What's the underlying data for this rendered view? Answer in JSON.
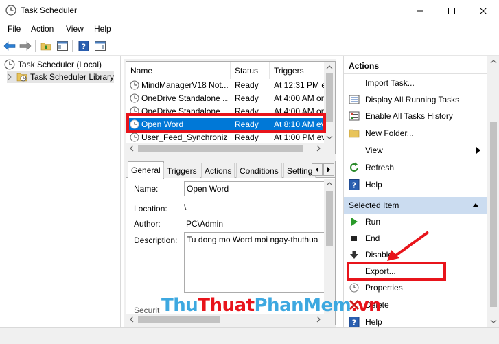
{
  "window": {
    "title": "Task Scheduler"
  },
  "menu": [
    "File",
    "Action",
    "View",
    "Help"
  ],
  "tree": {
    "root": "Task Scheduler (Local)",
    "library": "Task Scheduler Library"
  },
  "task_list": {
    "columns": [
      "Name",
      "Status",
      "Triggers"
    ],
    "rows": [
      {
        "name": "MindManagerV18 Not...",
        "status": "Ready",
        "trigger": "At 12:31 PM ev"
      },
      {
        "name": "OneDrive Standalone ...",
        "status": "Ready",
        "trigger": "At 4:00 AM on"
      },
      {
        "name": "OneDrive Standalone ...",
        "status": "Ready",
        "trigger": "At 4:00 AM on"
      },
      {
        "name": "Open Word",
        "status": "Ready",
        "trigger": "At 8:10 AM ev"
      },
      {
        "name": "User_Feed_Synchroniz...",
        "status": "Ready",
        "trigger": "At 1:00 PM ev"
      }
    ],
    "selected_index": 3
  },
  "details": {
    "tabs": [
      "General",
      "Triggers",
      "Actions",
      "Conditions",
      "Setting"
    ],
    "active_tab": "General",
    "name_label": "Name:",
    "name_value": "Open Word",
    "location_label": "Location:",
    "location_value": "\\",
    "author_label": "Author:",
    "author_value": "PC\\Admin",
    "description_label": "Description:",
    "description_value": "Tu dong mo Word moi ngay-thuthua",
    "security_partial": "Securit"
  },
  "actions_pane": {
    "header": "Actions",
    "items": [
      {
        "label": "Import Task...",
        "icon": "blank-icon"
      },
      {
        "label": "Display All Running Tasks",
        "icon": "running-tasks-icon"
      },
      {
        "label": "Enable All Tasks History",
        "icon": "history-icon"
      },
      {
        "label": "New Folder...",
        "icon": "folder-icon"
      },
      {
        "label": "View",
        "icon": "blank-icon"
      },
      {
        "label": "Refresh",
        "icon": "refresh-icon"
      },
      {
        "label": "Help",
        "icon": "help-icon"
      }
    ],
    "selected_header": "Selected Item",
    "selected_items": [
      {
        "label": "Run",
        "icon": "run-icon"
      },
      {
        "label": "End",
        "icon": "end-icon"
      },
      {
        "label": "Disable",
        "icon": "disable-icon"
      },
      {
        "label": "Export...",
        "icon": "blank-icon"
      },
      {
        "label": "Properties",
        "icon": "properties-icon"
      },
      {
        "label": "Delete",
        "icon": "delete-icon"
      },
      {
        "label": "Help",
        "icon": "help-icon"
      }
    ]
  },
  "watermark": {
    "part1": "Thu",
    "part2": "Thuat",
    "part3": "PhanMem",
    "part4": ".vn"
  },
  "colors": {
    "selection": "#0078d7",
    "highlight_red": "#e8141b",
    "section_header": "#cbdcf0"
  }
}
